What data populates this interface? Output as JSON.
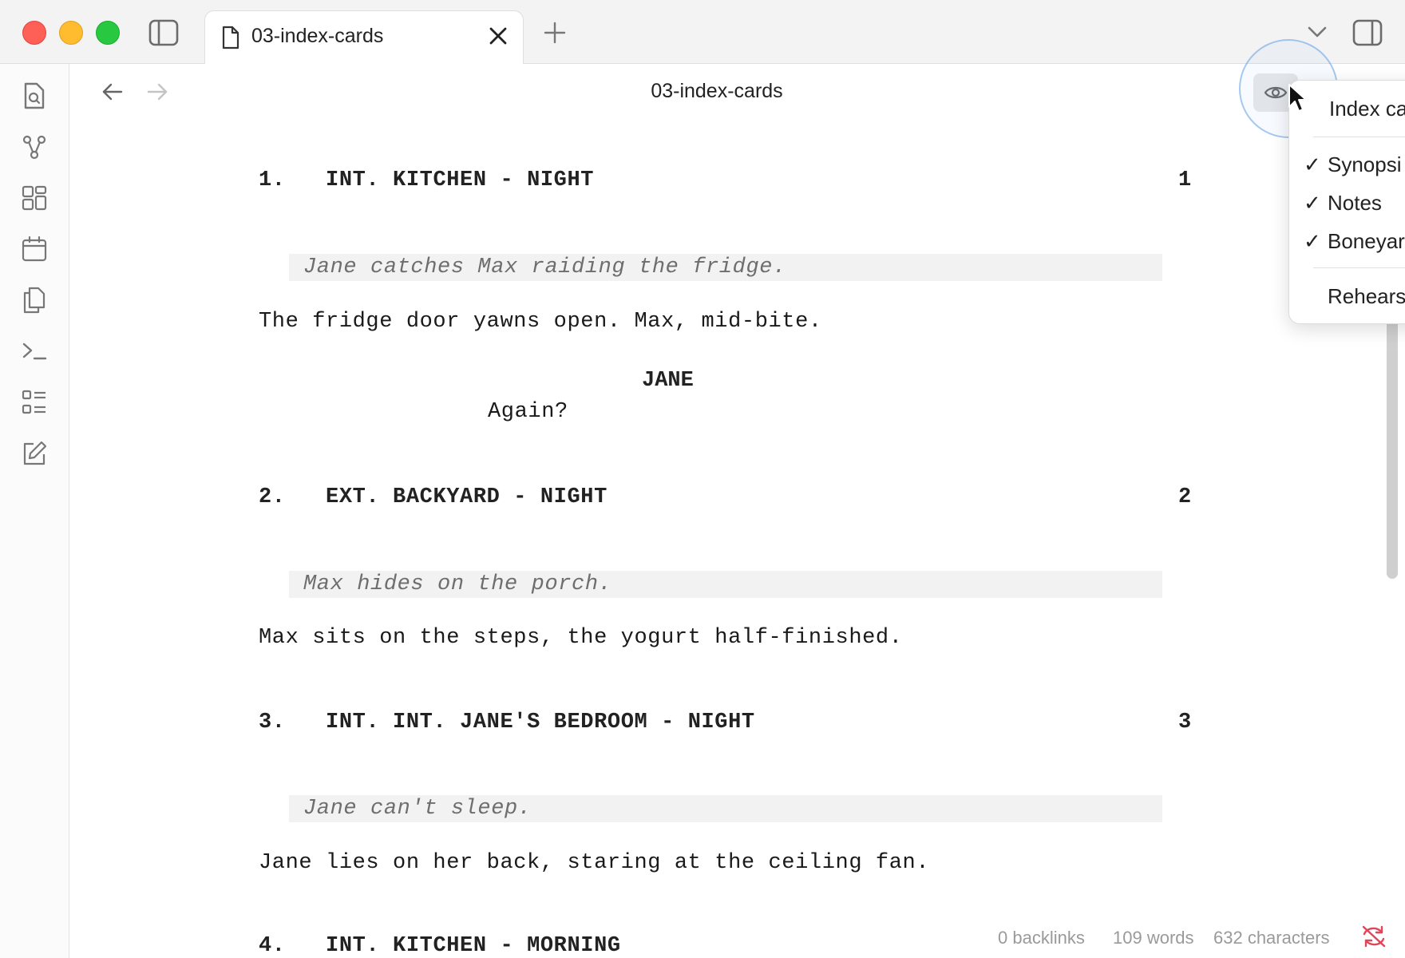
{
  "tab": {
    "title": "03-index-cards"
  },
  "header": {
    "title": "03-index-cards"
  },
  "menu": {
    "items": [
      {
        "label": "Index ca",
        "checked": false
      },
      {
        "label": "Synopsi",
        "checked": true
      },
      {
        "label": "Notes",
        "checked": true
      },
      {
        "label": "Boneyar",
        "checked": true
      },
      {
        "label": "Rehears",
        "checked": false
      }
    ],
    "check_glyph": "✓"
  },
  "screenplay": {
    "scenes": [
      {
        "index": "1.",
        "heading": "INT. KITCHEN - NIGHT",
        "number": "1",
        "synopsis": "Jane catches Max raiding the fridge.",
        "action": "The fridge door yawns open. Max, mid-bite.",
        "character": "JANE",
        "dialogue": "Again?"
      },
      {
        "index": "2.",
        "heading": "EXT. BACKYARD - NIGHT",
        "number": "2",
        "synopsis": "Max hides on the porch.",
        "action": "Max sits on the steps, the yogurt half-finished."
      },
      {
        "index": "3.",
        "heading": "INT. INT. JANE'S BEDROOM - NIGHT",
        "number": "3",
        "synopsis": "Jane can't sleep.",
        "action": "Jane lies on her back, staring at the ceiling fan."
      },
      {
        "index": "4.",
        "heading": "INT. KITCHEN - MORNING"
      }
    ]
  },
  "status": {
    "backlinks": "0 backlinks",
    "words": "109 words",
    "characters": "632 characters"
  },
  "colors": {
    "close": "#fe5f57",
    "minimize": "#febc2e",
    "zoom": "#28c840",
    "sync_error": "#e0455a"
  }
}
